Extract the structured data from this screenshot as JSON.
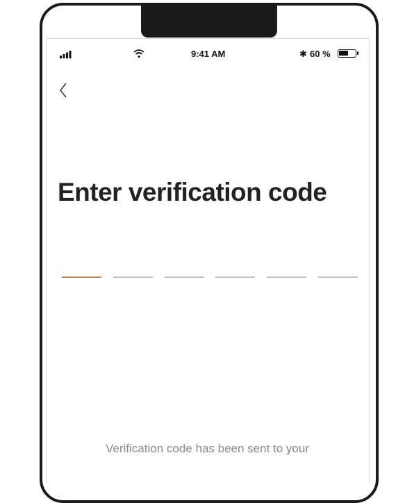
{
  "status_bar": {
    "time": "9:41 AM",
    "battery_percent": "60 %",
    "battery_level": 0.6,
    "icons": [
      "signal-icon",
      "wifi-icon",
      "bluetooth-icon",
      "battery-icon"
    ]
  },
  "nav": {
    "back_icon": "chevron-left-icon"
  },
  "main": {
    "title": "Enter verification code",
    "code_length": 6,
    "active_slot": 0,
    "hint": "Verification code has been sent to your"
  },
  "colors": {
    "accent": "#d9803d",
    "slot_inactive": "#bfbfbf",
    "text_primary": "#222222",
    "text_secondary": "#8a8a8a",
    "frame": "#1a1a1a"
  }
}
